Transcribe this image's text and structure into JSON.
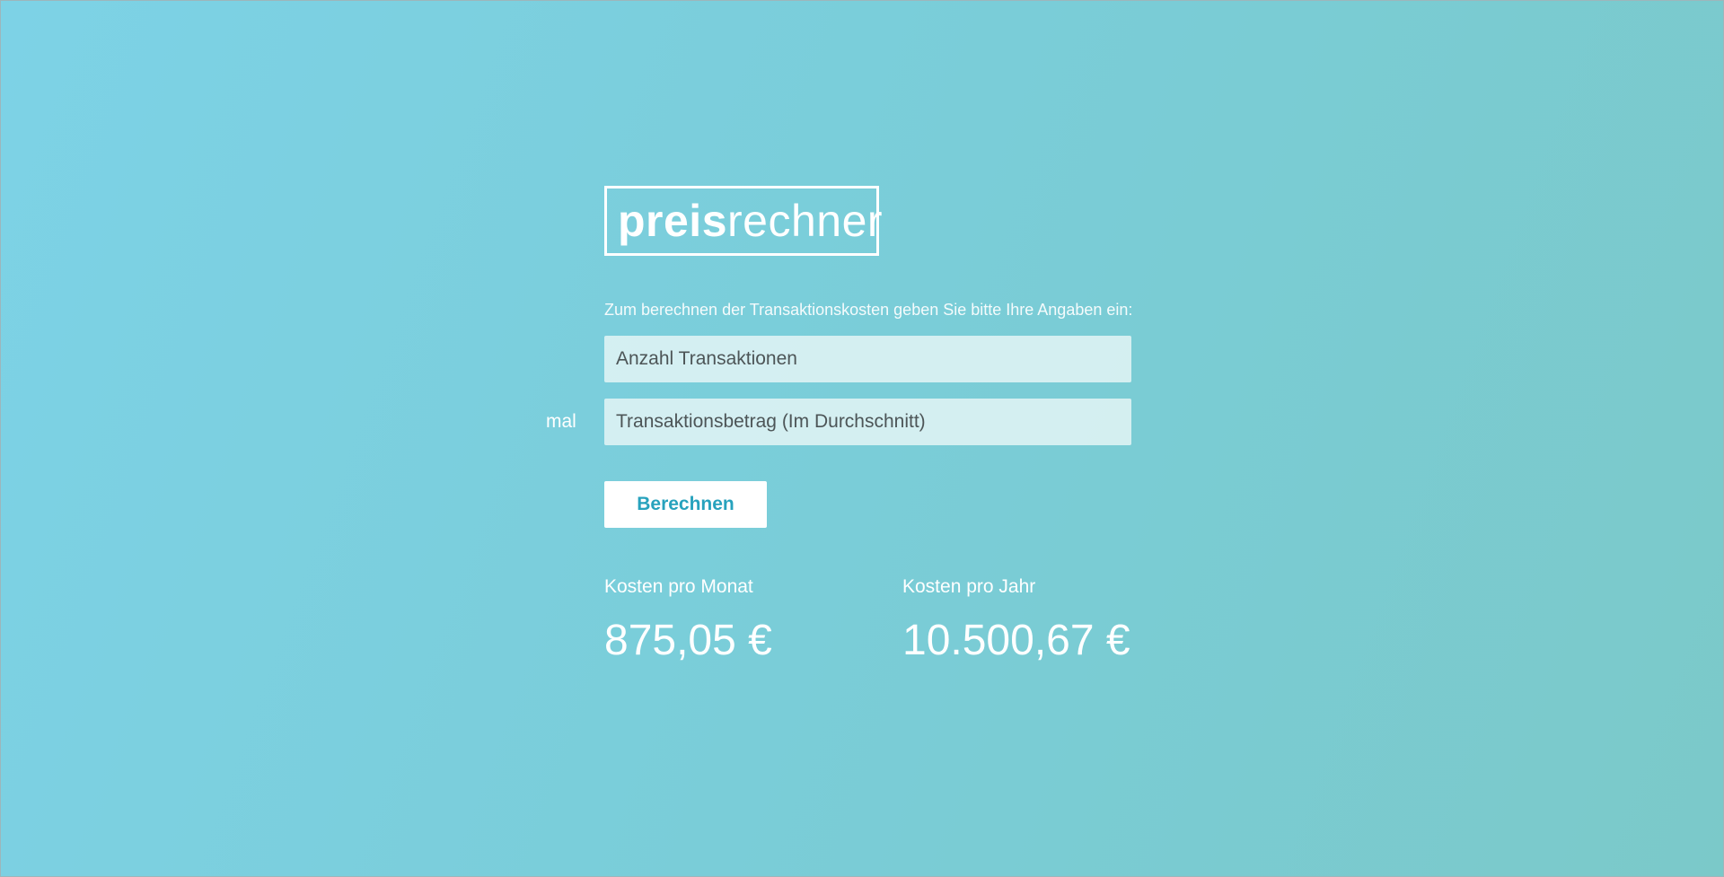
{
  "logo": {
    "text_strong": "preis",
    "text_light": "rechner"
  },
  "form": {
    "intro": "Zum berechnen der Transaktionskosten geben Sie bitte Ihre Angaben ein:",
    "transactions_placeholder": "Anzahl Transaktionen",
    "multiplier_label": "mal",
    "amount_placeholder": "Transaktionsbetrag (Im Durchschnitt)",
    "submit_label": "Berechnen"
  },
  "results": {
    "monthly_label": "Kosten pro Monat",
    "monthly_value": "875,05 €",
    "yearly_label": "Kosten pro Jahr",
    "yearly_value": "10.500,67 €"
  },
  "colors": {
    "background_start": "#7dd2e6",
    "background_end": "#7bc9c9",
    "button_text": "#27a2bd",
    "input_text": "#4d5557"
  }
}
